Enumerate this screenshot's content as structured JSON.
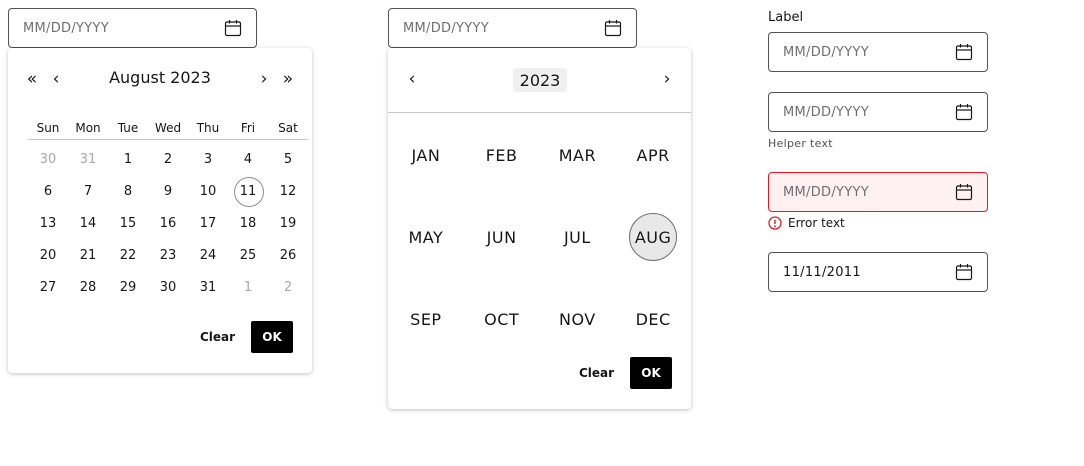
{
  "picker1": {
    "input_placeholder": "MM/DD/YYYY",
    "month_title": "August 2023",
    "nav": {
      "prev_year": "«",
      "prev_month": "‹",
      "next_month": "›",
      "next_year": "»"
    },
    "weekdays": [
      "Sun",
      "Mon",
      "Tue",
      "Wed",
      "Thu",
      "Fri",
      "Sat"
    ],
    "days": [
      {
        "d": "30",
        "muted": true
      },
      {
        "d": "31",
        "muted": true
      },
      {
        "d": "1"
      },
      {
        "d": "2"
      },
      {
        "d": "3"
      },
      {
        "d": "4"
      },
      {
        "d": "5"
      },
      {
        "d": "6"
      },
      {
        "d": "7"
      },
      {
        "d": "8"
      },
      {
        "d": "9"
      },
      {
        "d": "10"
      },
      {
        "d": "11",
        "today": true
      },
      {
        "d": "12"
      },
      {
        "d": "13"
      },
      {
        "d": "14"
      },
      {
        "d": "15"
      },
      {
        "d": "16"
      },
      {
        "d": "17"
      },
      {
        "d": "18"
      },
      {
        "d": "19"
      },
      {
        "d": "20"
      },
      {
        "d": "21"
      },
      {
        "d": "22"
      },
      {
        "d": "23"
      },
      {
        "d": "24"
      },
      {
        "d": "25"
      },
      {
        "d": "26"
      },
      {
        "d": "27"
      },
      {
        "d": "28"
      },
      {
        "d": "29"
      },
      {
        "d": "30"
      },
      {
        "d": "31"
      },
      {
        "d": "1",
        "muted": true
      },
      {
        "d": "2",
        "muted": true
      }
    ],
    "clear_label": "Clear",
    "ok_label": "OK"
  },
  "picker2": {
    "input_placeholder": "MM/DD/YYYY",
    "year": "2023",
    "nav": {
      "prev": "‹",
      "next": "›"
    },
    "months": [
      "JAN",
      "FEB",
      "MAR",
      "APR",
      "MAY",
      "JUN",
      "JUL",
      "AUG",
      "SEP",
      "OCT",
      "NOV",
      "DEC"
    ],
    "selected_month": "AUG",
    "clear_label": "Clear",
    "ok_label": "OK"
  },
  "fields": {
    "label": "Label",
    "labeled_placeholder": "MM/DD/YYYY",
    "helper_placeholder": "MM/DD/YYYY",
    "helper_text": "Helper text",
    "error_placeholder": "MM/DD/YYYY",
    "error_text": "Error text",
    "filled_value": "11/11/2011"
  },
  "colors": {
    "border": "#525252",
    "error": "#da1e28",
    "error_bg": "#fff1f1",
    "primary_button": "#000000",
    "selected_fill": "#e8e8e8"
  },
  "icons": {
    "calendar": "calendar-icon",
    "error": "error-circle-icon"
  }
}
